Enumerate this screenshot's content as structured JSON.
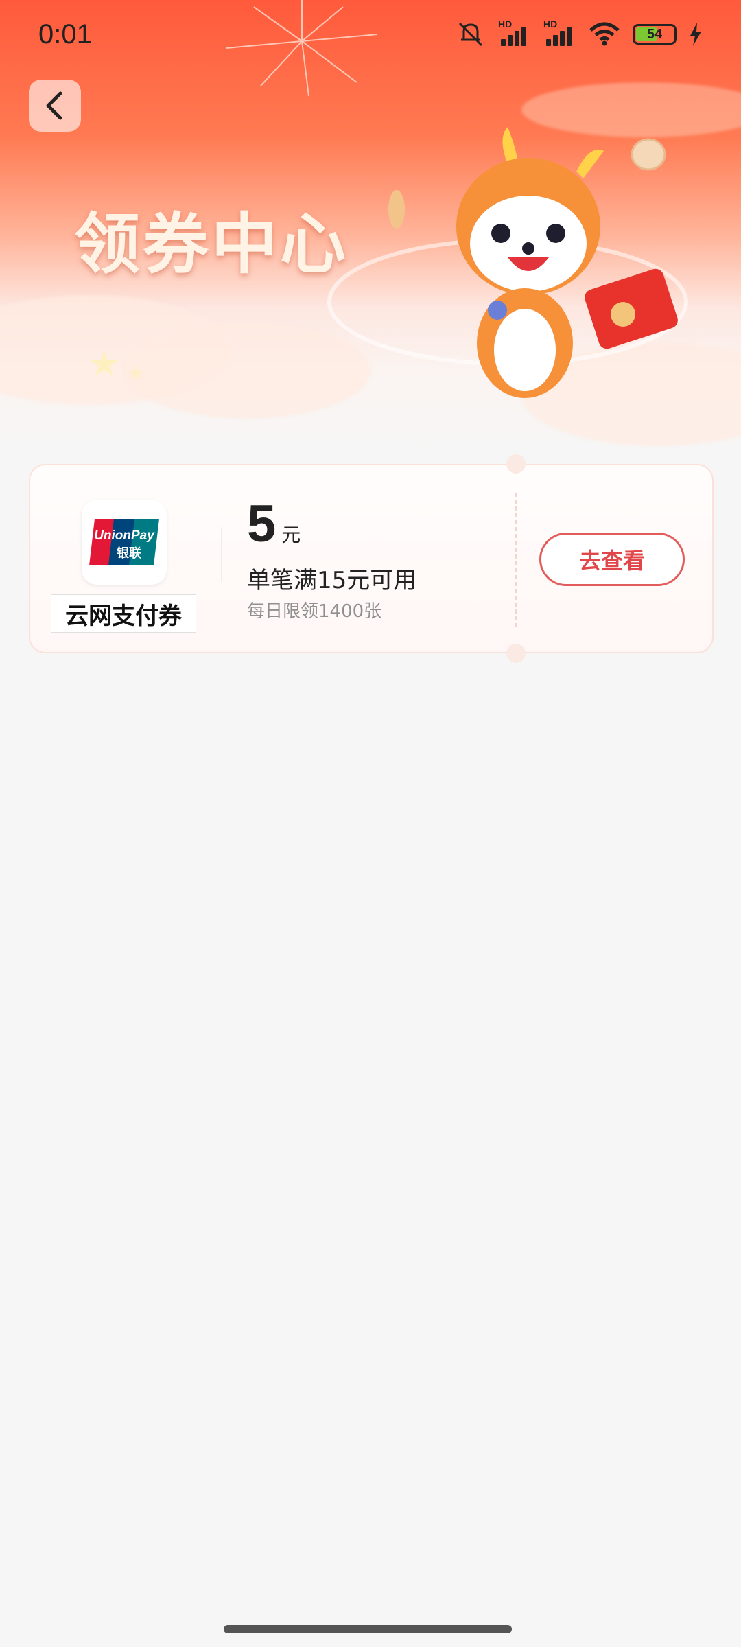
{
  "status_bar": {
    "time": "0:01",
    "battery": "54",
    "hd1": "HD",
    "hd2": "HD"
  },
  "header": {
    "title": "领券中心",
    "back_icon": "chevron-left-icon"
  },
  "coupon": {
    "brand": "云网支付券",
    "logo_text_top": "UnionPay",
    "logo_text_bottom": "银联",
    "amount": "5",
    "unit": "元",
    "condition": "单笔满15元可用",
    "limit": "每日限领1400张",
    "button_label": "去查看"
  },
  "colors": {
    "accent": "#e0464a",
    "hero_top": "#ff5a3c",
    "background": "#f6f6f6"
  }
}
